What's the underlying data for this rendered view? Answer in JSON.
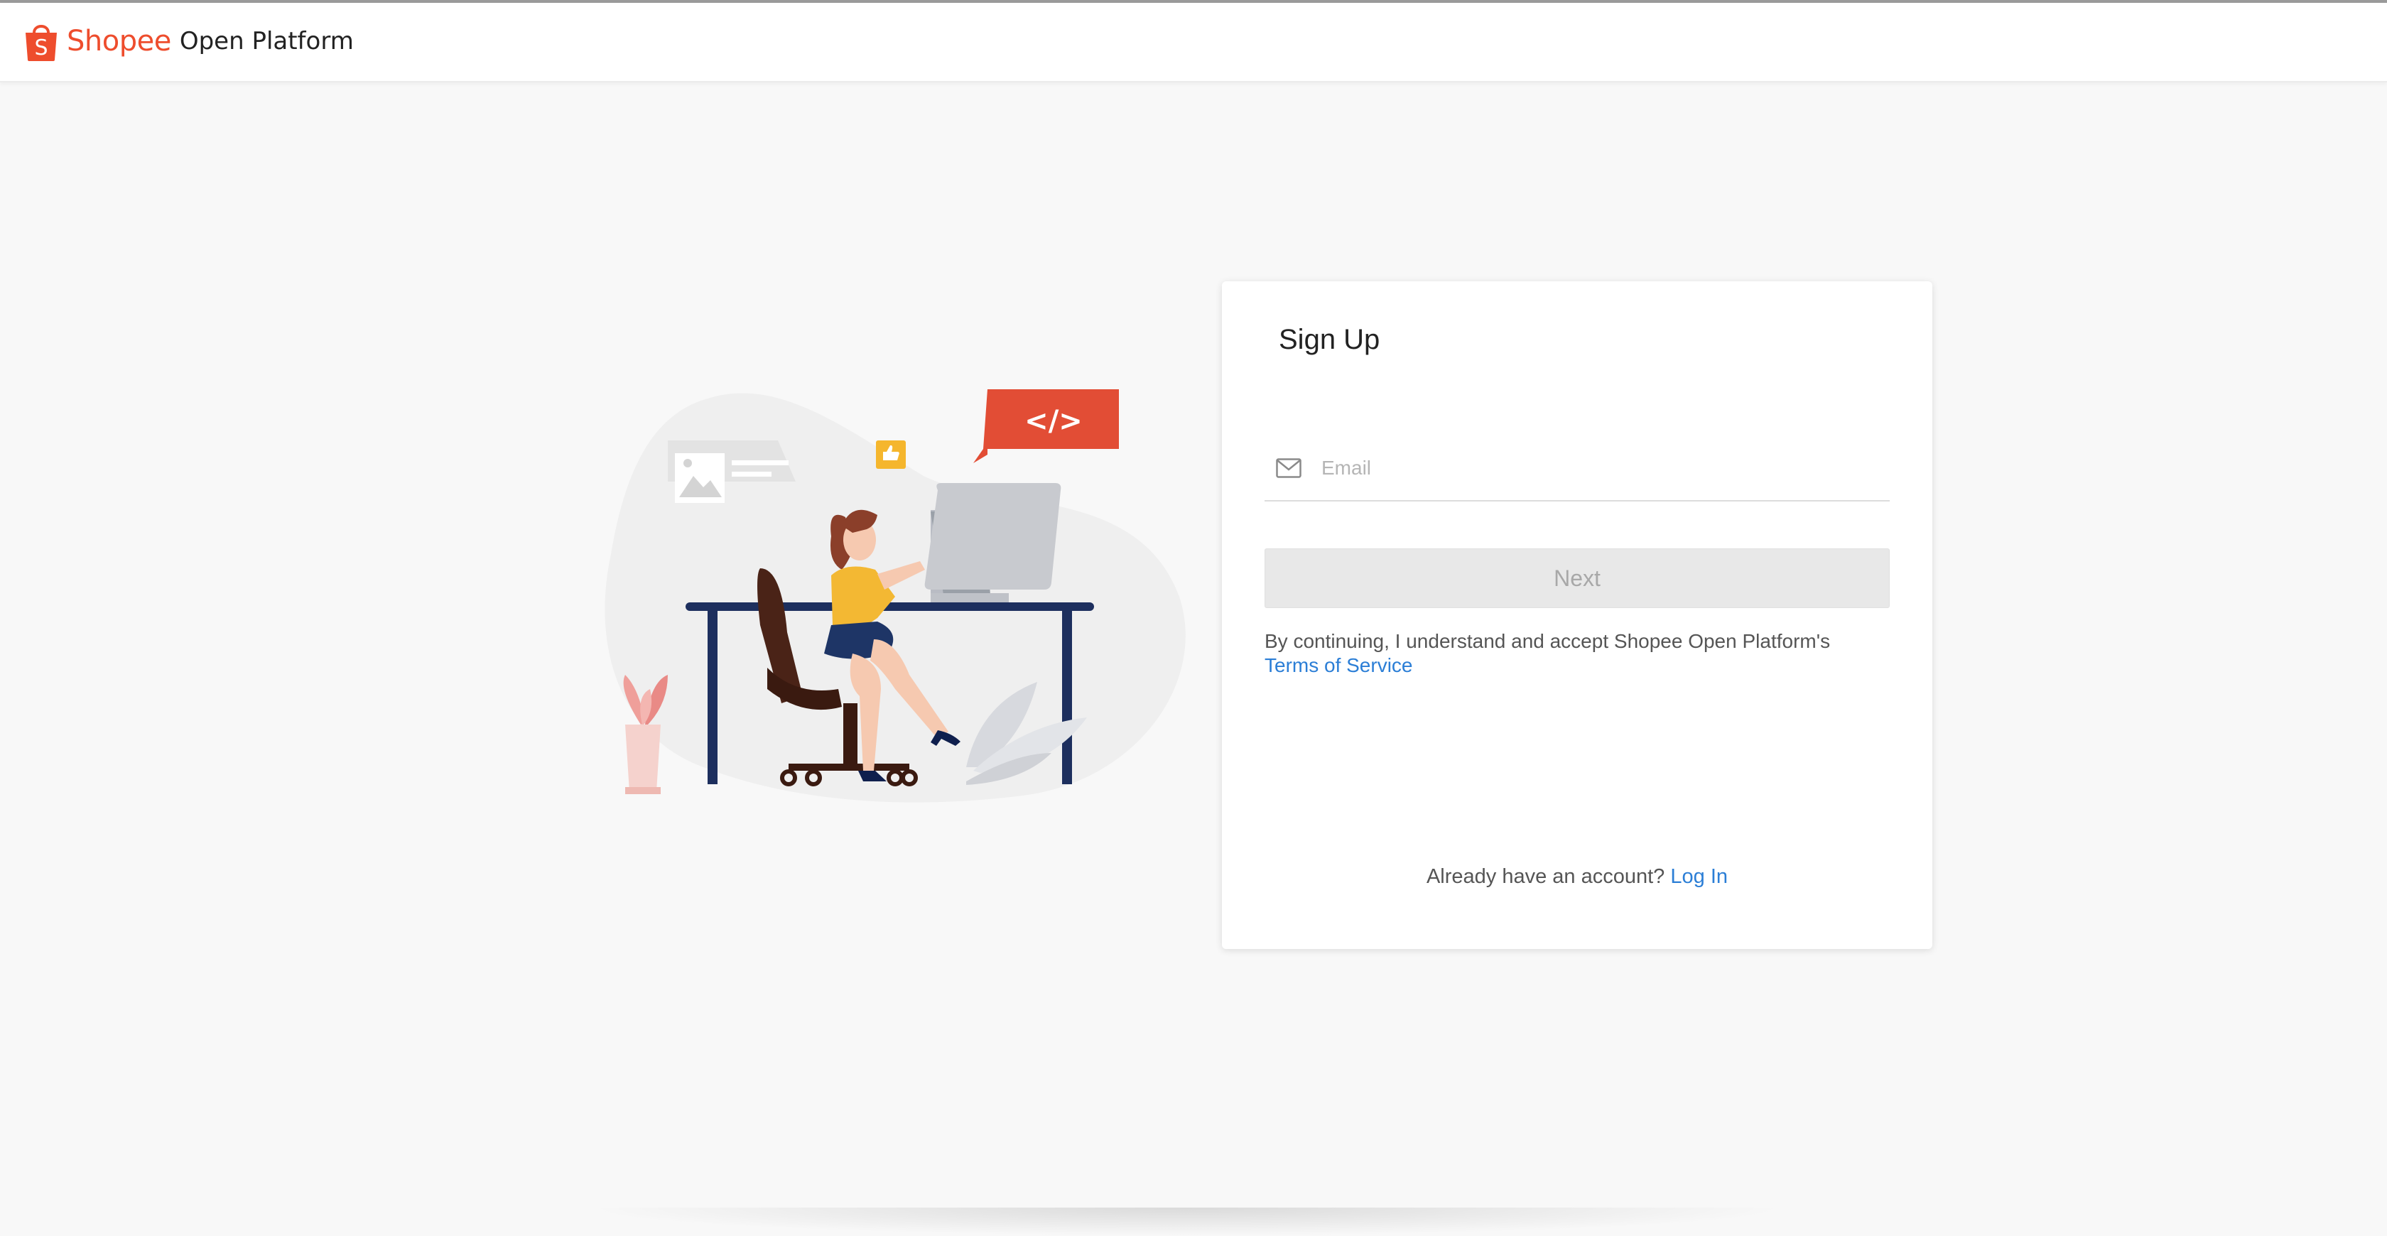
{
  "header": {
    "brand": "Shopee",
    "product": "Open Platform",
    "logo_icon": "shopping-bag-icon",
    "logo_letter": "S"
  },
  "illustration": {
    "code_badge": "</>",
    "icons": [
      "code-speech-bubble-icon",
      "thumbs-up-icon",
      "image-card-icon"
    ]
  },
  "signup": {
    "title": "Sign Up",
    "email_placeholder": "Email",
    "email_value": "",
    "email_icon": "mail-icon",
    "next_label": "Next",
    "terms_text": "By continuing, I understand and accept Shopee Open Platform's",
    "terms_link": "Terms of Service",
    "login_prompt": "Already have an account?",
    "login_link": "Log In"
  },
  "colors": {
    "brand": "#ee4d2d",
    "link": "#2b7ed6",
    "page_bg": "#f8f8f8",
    "navy": "#1d2f5e",
    "yellow": "#f5b62d"
  }
}
